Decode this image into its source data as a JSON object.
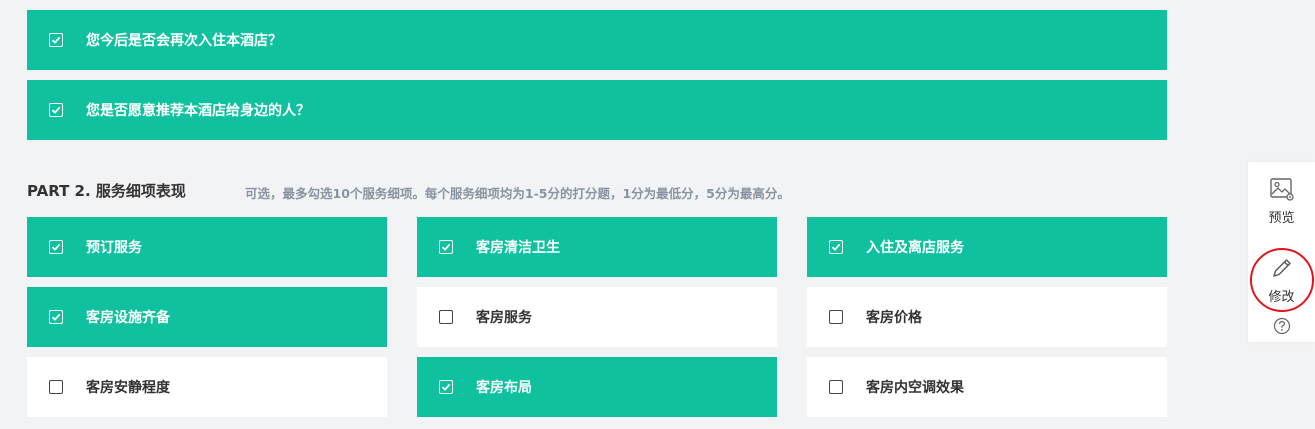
{
  "top_questions": [
    {
      "label": "您今后是否会再次入住本酒店？",
      "checked": true
    },
    {
      "label": "您是否愿意推荐本酒店给身边的人？",
      "checked": true
    }
  ],
  "part2": {
    "title": "PART 2. 服务细项表现",
    "description": "可选，最多勾选10个服务细项。每个服务细项均为1-5分的打分题，1分为最低分，5分为最高分。"
  },
  "items": [
    {
      "label": "预订服务",
      "checked": true
    },
    {
      "label": "客房清洁卫生",
      "checked": true
    },
    {
      "label": "入住及离店服务",
      "checked": true
    },
    {
      "label": "客房设施齐备",
      "checked": true
    },
    {
      "label": "客房服务",
      "checked": false
    },
    {
      "label": "客房价格",
      "checked": false
    },
    {
      "label": "客房安静程度",
      "checked": false
    },
    {
      "label": "客房布局",
      "checked": true
    },
    {
      "label": "客房内空调效果",
      "checked": false
    }
  ],
  "side_panel": {
    "preview_label": "预览",
    "edit_label": "修改",
    "help_icon": "help-circle-icon",
    "accent_color": "#e0161c"
  },
  "colors": {
    "selected": "#0fc19f",
    "unselected": "#ffffff",
    "background": "#f2f3f5"
  }
}
